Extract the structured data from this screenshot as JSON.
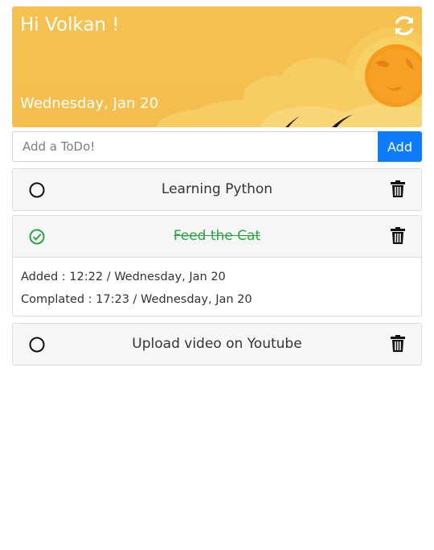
{
  "header": {
    "greeting": "Hi Volkan !",
    "date": "Wednesday, Jan 20",
    "refresh_icon": "refresh-icon"
  },
  "add_form": {
    "placeholder": "Add a ToDo!",
    "button_label": "Add"
  },
  "todos": [
    {
      "title": "Learning Python",
      "completed": false
    },
    {
      "title": "Feed the Cat",
      "completed": true,
      "added": "Added : 12:22 / Wednesday, Jan 20",
      "completed_at": "Complated : 17:23 / Wednesday, Jan 20"
    },
    {
      "title": "Upload video on Youtube",
      "completed": false
    }
  ],
  "colors": {
    "banner": "#f3be4e",
    "accent": "#0d7bfd",
    "done": "#28a745"
  }
}
